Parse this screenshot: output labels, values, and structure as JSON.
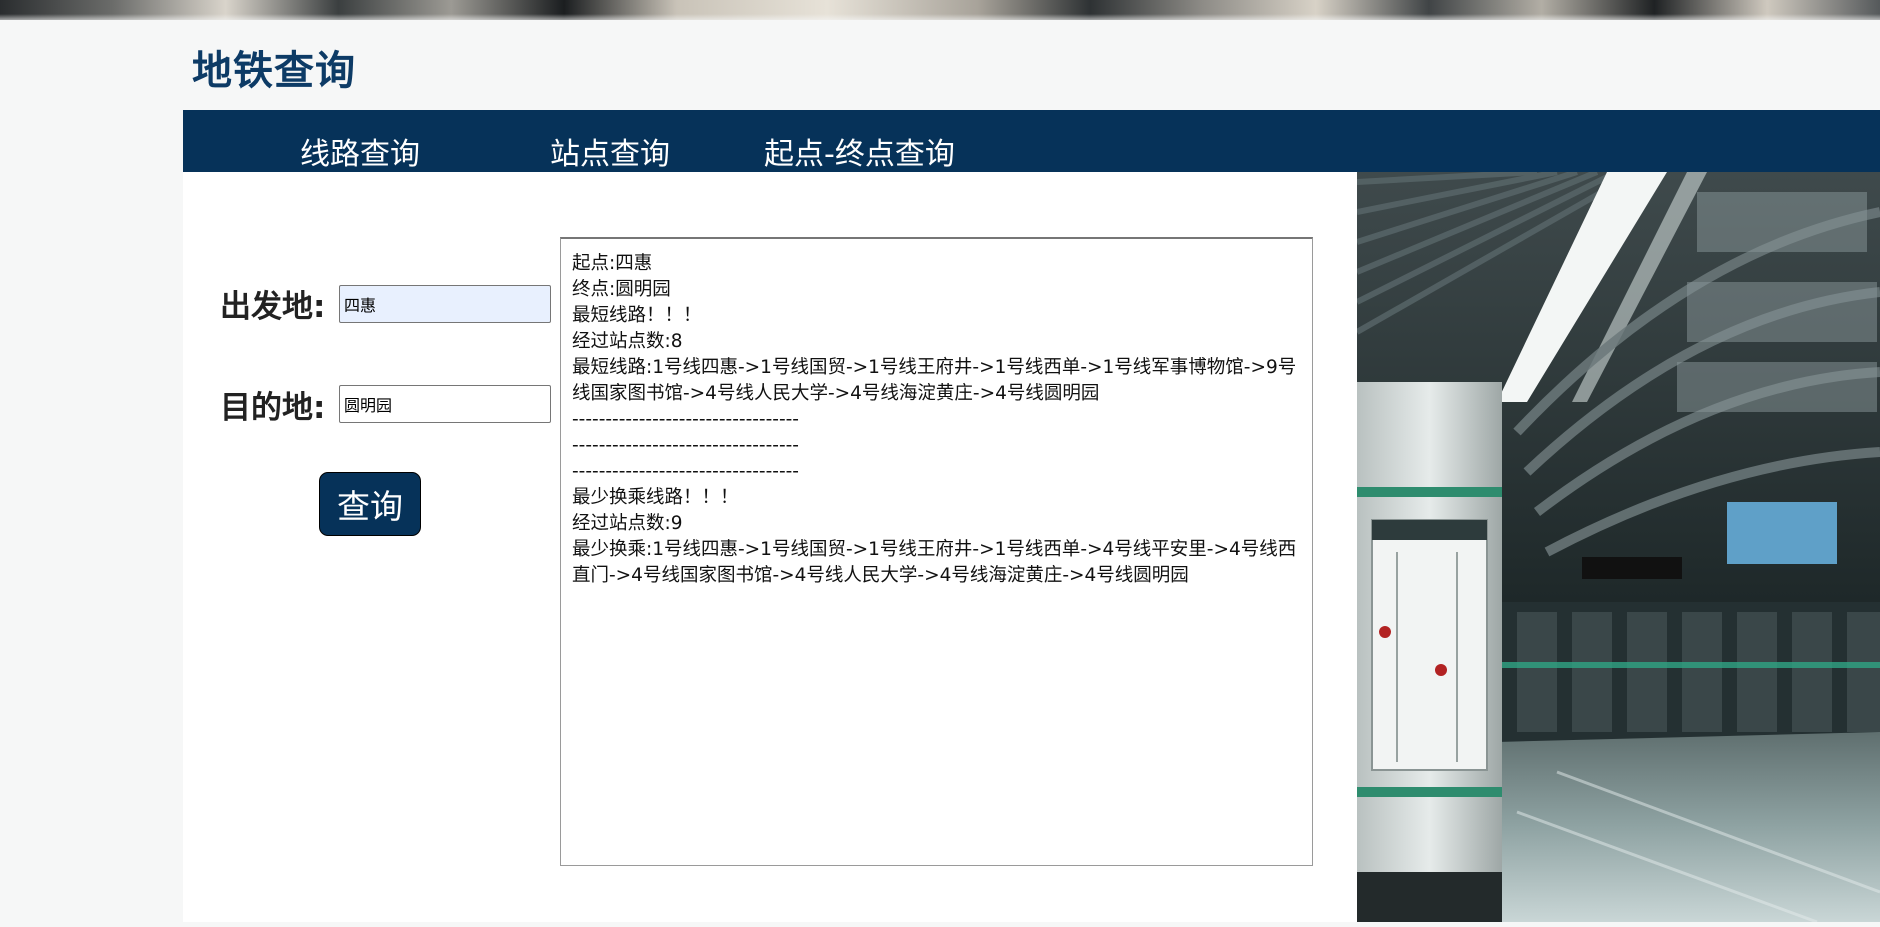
{
  "header": {
    "title": "地铁查询"
  },
  "nav": {
    "items": [
      {
        "label": "线路查询"
      },
      {
        "label": "站点查询"
      },
      {
        "label": "起点-终点查询"
      }
    ]
  },
  "form": {
    "from_label": "出发地:",
    "from_value": "四惠",
    "to_label": "目的地:",
    "to_value": "圆明园",
    "submit_label": "查询"
  },
  "result": {
    "lines": [
      "起点:四惠",
      "终点:圆明园",
      "最短线路！！！",
      "经过站点数:8",
      "最短线路:1号线四惠->1号线国贸->1号线王府井->1号线西单->1号线军事博物馆->9号线国家图书馆->4号线人民大学->4号线海淀黄庄->4号线圆明园",
      "----------------------------------",
      "----------------------------------",
      "----------------------------------",
      "最少换乘线路！！！",
      "经过站点数:9",
      "最少换乘:1号线四惠->1号线国贸->1号线王府井->1号线西单->4号线平安里->4号线西直门->4号线国家图书馆->4号线人民大学->4号线海淀黄庄->4号线圆明园"
    ]
  },
  "colors": {
    "brand_navy": "#063259",
    "title_blue": "#0d3b66",
    "autofill_bg": "#e8f0fe"
  }
}
